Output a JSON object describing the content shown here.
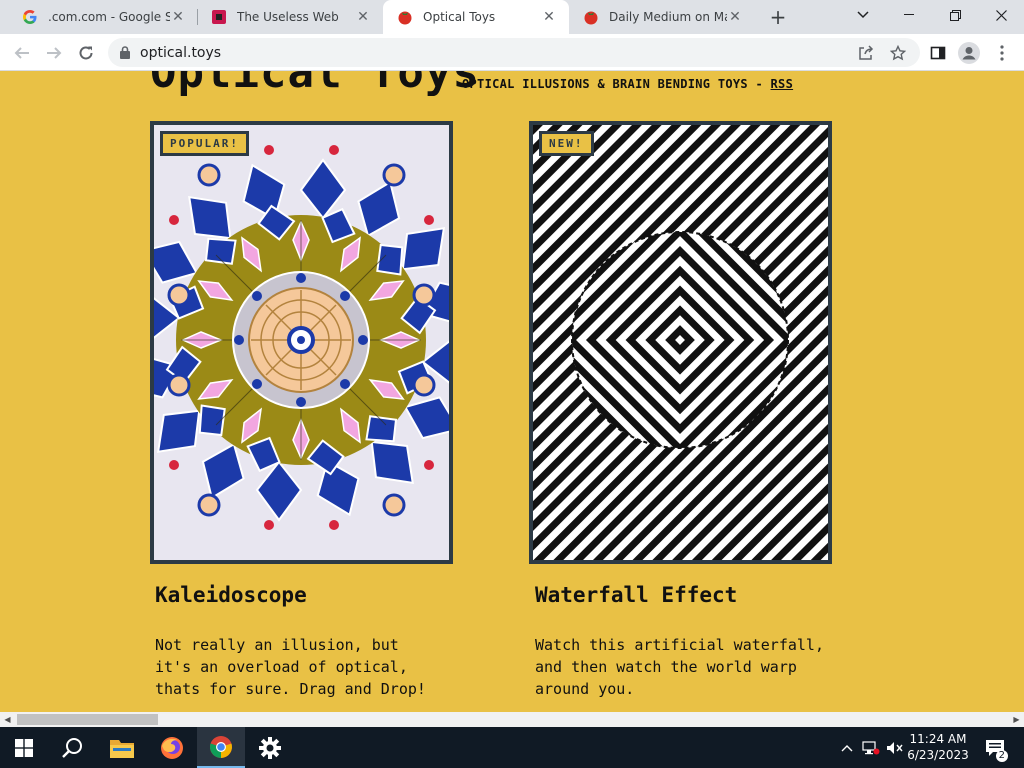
{
  "browser": {
    "tabs": [
      {
        "title": ".com.com - Google Sea",
        "favicon": "google-g-icon",
        "active": false
      },
      {
        "title": "The Useless Web",
        "favicon": "useless-web-icon",
        "active": false
      },
      {
        "title": "Optical Toys",
        "favicon": "tomato-icon",
        "active": true
      },
      {
        "title": "Daily Medium on Maze",
        "favicon": "tomato-icon",
        "active": false
      }
    ],
    "url": "optical.toys"
  },
  "page": {
    "site_title": "Optical Toys",
    "tagline": "OPTICAL ILLUSIONS & BRAIN BENDING TOYS - ",
    "rss_label": "RSS",
    "cards": [
      {
        "badge": "POPULAR!",
        "title": "Kaleidoscope",
        "description": "Not really an illusion, but\nit's an overload of optical,\nthats for sure. Drag and Drop!"
      },
      {
        "badge": "NEW!",
        "title": "Waterfall Effect",
        "description": "Watch this artificial waterfall,\nand then watch the world warp\naround you."
      }
    ]
  },
  "taskbar": {
    "time": "11:24 AM",
    "date": "6/23/2023",
    "notification_count": "2"
  },
  "colors": {
    "page_background": "#e9c145",
    "card_border": "#2c3a45",
    "taskbar": "#101a25"
  }
}
